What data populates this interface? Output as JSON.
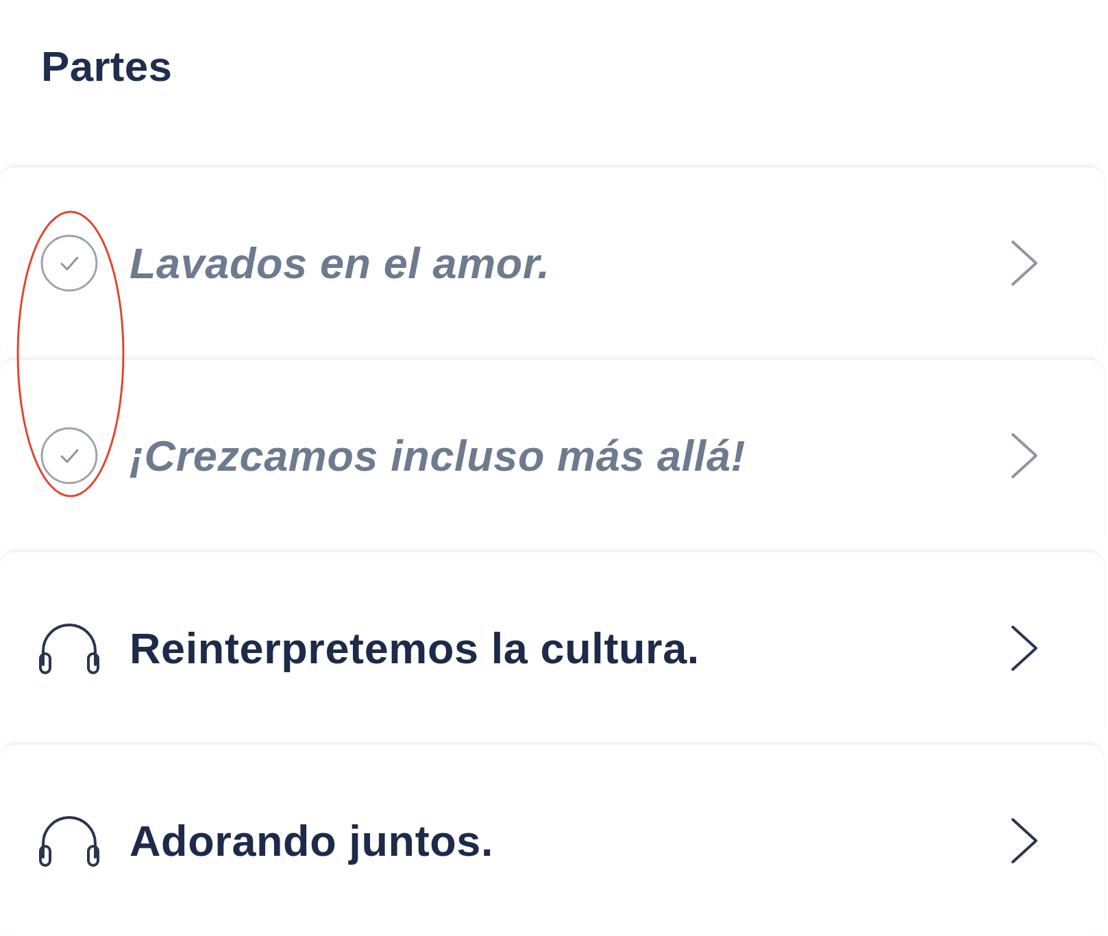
{
  "header": {
    "title": "Partes"
  },
  "parts": [
    {
      "title": "Lavados en el amor.",
      "completed": true,
      "circled": true
    },
    {
      "title": "¡Crezcamos incluso más allá!",
      "completed": true,
      "circled": true
    },
    {
      "title": "Reinterpretemos la cultura.",
      "completed": false,
      "circled": false
    },
    {
      "title": "Adorando juntos.",
      "completed": false,
      "circled": false
    }
  ]
}
